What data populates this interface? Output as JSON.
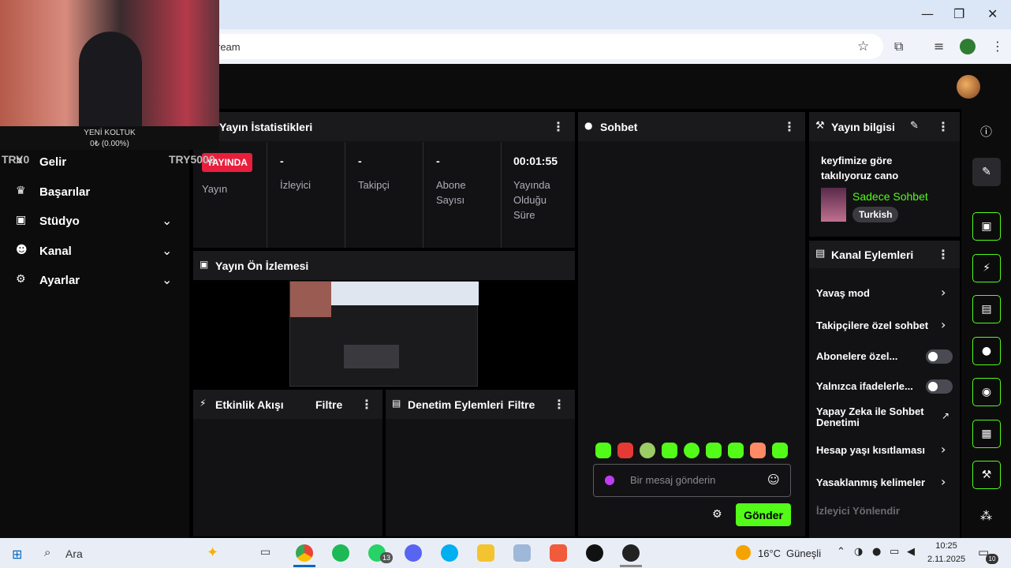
{
  "browser": {
    "url_text": "ream"
  },
  "webcam": {
    "title": "YENİ KOLTUK",
    "progress": "0₺ (0.00%)",
    "left_text": "TRY0",
    "right_text": "TRY5000"
  },
  "sidebar": {
    "items": [
      {
        "label": "Gelir",
        "icon": "money-icon"
      },
      {
        "label": "Başarılar",
        "icon": "trophy-icon"
      },
      {
        "label": "Stüdyo",
        "icon": "studio-icon",
        "expandable": true
      },
      {
        "label": "Kanal",
        "icon": "users-icon",
        "expandable": true
      },
      {
        "label": "Ayarlar",
        "icon": "gear-icon",
        "expandable": true
      }
    ]
  },
  "stats": {
    "title": "Yayın İstatistikleri",
    "live_badge": "YAYINDA",
    "items": [
      {
        "value": "",
        "label": "Yayın"
      },
      {
        "value": "-",
        "label": "İzleyici"
      },
      {
        "value": "-",
        "label": "Takipçi"
      },
      {
        "value": "-",
        "label": "Abone Sayısı"
      },
      {
        "value": "00:01:55",
        "label": "Yayında Olduğu Süre"
      }
    ]
  },
  "preview": {
    "title": "Yayın Ön İzlemesi"
  },
  "activity": {
    "title": "Etkinlik Akışı",
    "filter": "Filtre"
  },
  "moderation": {
    "title": "Denetim Eylemleri",
    "filter": "Filtre"
  },
  "chat": {
    "title": "Sohbet",
    "placeholder": "Bir mesaj gönderin",
    "send_label": "Gönder"
  },
  "stream_info": {
    "title": "Yayın bilgisi",
    "stream_title": "keyfimize göre takılıyoruz cano",
    "category": "Sadece Sohbet",
    "tag": "Turkish"
  },
  "channel_actions": {
    "title": "Kanal Eylemleri",
    "items": [
      {
        "label": "Yavaş mod",
        "control": "chevron"
      },
      {
        "label": "Takipçilere özel sohbet",
        "control": "chevron"
      },
      {
        "label": "Abonelere özel...",
        "control": "toggle"
      },
      {
        "label": "Yalnızca ifadelerle...",
        "control": "toggle"
      },
      {
        "label": "Yapay Zeka ile Sohbet Denetimi",
        "control": "external"
      },
      {
        "label": "Hesap yaşı kısıtlaması",
        "control": "chevron"
      },
      {
        "label": "Yasaklanmış kelimeler",
        "control": "chevron"
      },
      {
        "label": "İzleyici Yönlendir",
        "control": "none"
      }
    ]
  },
  "taskbar": {
    "search_label": "Ara",
    "weather_temp": "16°C",
    "weather_desc": "Güneşli",
    "time": "10:25",
    "date": "2.11.2025",
    "whatsapp_badge": "13",
    "notif_badge": "10"
  },
  "colors": {
    "accent": "#53fc18",
    "live": "#e91e3c",
    "bg": "#000000",
    "panel": "#121214"
  }
}
